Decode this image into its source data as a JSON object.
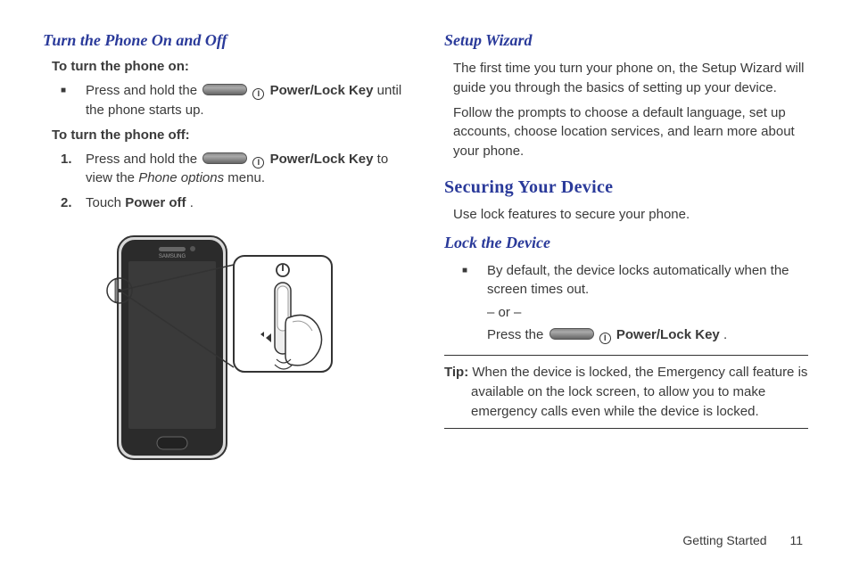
{
  "left": {
    "heading": "Turn the Phone On and Off",
    "onLabel": "To turn the phone on:",
    "onItem_pre": "Press and hold the ",
    "powerKeyLabel": "Power/Lock Key",
    "onItem_post": " until the phone starts up.",
    "offLabel": "To turn the phone off:",
    "off1_pre": "Press and hold the ",
    "off1_mid": " to view the ",
    "off1_menu": "Phone options",
    "off1_post": " menu.",
    "off2_pre": "Touch ",
    "off2_strong": "Power off",
    "off2_post": ".",
    "num1": "1.",
    "num2": "2."
  },
  "right": {
    "setupHeading": "Setup Wizard",
    "setupP1": "The first time you turn your phone on, the Setup Wizard will guide you through the basics of setting up your device.",
    "setupP2": "Follow the prompts to choose a default language, set up accounts, choose location services, and learn more about your phone.",
    "secureHeading": "Securing Your Device",
    "secureIntro": "Use lock features to secure your phone.",
    "lockHeading": "Lock the Device",
    "lockItem": "By default, the device locks automatically when the screen times out.",
    "orText": "– or –",
    "pressPre": "Press the ",
    "pressPost": ".",
    "tipLabel": "Tip:",
    "tipText": " When the device is locked, the Emergency call feature is available on the lock screen, to allow you to make emergency calls even while the device is locked."
  },
  "icon": {
    "powerChar": "I"
  },
  "footer": {
    "section": "Getting Started",
    "page": "11"
  }
}
